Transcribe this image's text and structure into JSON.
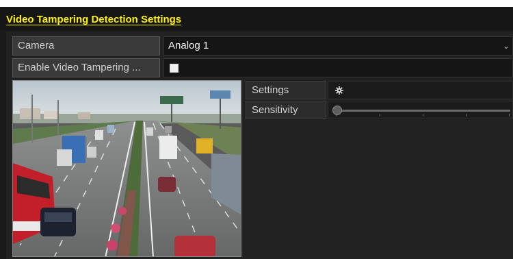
{
  "page_title": "Video Tampering Detection Settings",
  "camera": {
    "label": "Camera",
    "value": "Analog 1"
  },
  "enable": {
    "label": "Enable Video Tampering ...",
    "checked": false
  },
  "settings": {
    "label": "Settings",
    "icon": "gear-icon"
  },
  "sensitivity": {
    "label": "Sensitivity",
    "level": 0
  },
  "preview": {
    "content": "live camera view of highway traffic"
  },
  "colors": {
    "title": "#fff200",
    "background": "#1a1a1a"
  }
}
